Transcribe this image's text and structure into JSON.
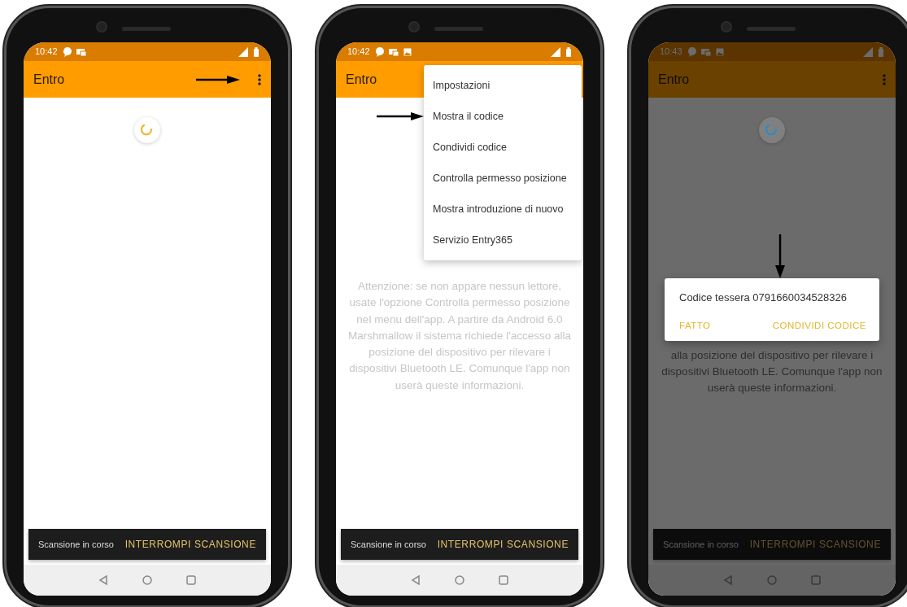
{
  "phones": [
    {
      "status_time": "10:42",
      "status_icons": [
        {
          "kind": "chat"
        },
        {
          "kind": "card"
        }
      ],
      "app_title": "Entro",
      "dimmed": false,
      "spinner": {
        "color": "#f0b429"
      },
      "arrow": {
        "kind": "overflow"
      },
      "snackbar": {
        "text": "Scansione in corso",
        "action": "INTERROMPI SCANSIONE"
      }
    },
    {
      "status_time": "10:42",
      "status_icons": [
        {
          "kind": "chat"
        },
        {
          "kind": "card"
        },
        {
          "kind": "image"
        }
      ],
      "app_title": "Entro",
      "dimmed": false,
      "menu": [
        {
          "label": "Impostazioni",
          "pointed": false
        },
        {
          "label": "Mostra il codice",
          "pointed": true
        },
        {
          "label": "Condividi codice",
          "pointed": false
        },
        {
          "label": "Controlla permesso posizione",
          "pointed": false
        },
        {
          "label": "Mostra introduzione di nuovo",
          "pointed": false
        },
        {
          "label": "Servizio Entry365",
          "pointed": false
        }
      ],
      "arrow": {
        "kind": "menu"
      },
      "message": "Attenzione: se non appare nessun lettore, usate l'opzione Controlla permesso posizione nel menu dell'app. A partire da Android 6.0 Marshmallow il sistema richiede l'accesso alla posizione del dispositivo per rilevare i dispositivi Bluetooth LE. Comunque l'app non userà queste informazioni.",
      "snackbar": {
        "text": "Scansione in corso",
        "action": "INTERROMPI SCANSIONE"
      }
    },
    {
      "status_time": "10:43",
      "status_icons": [
        {
          "kind": "chat"
        },
        {
          "kind": "card"
        },
        {
          "kind": "image"
        }
      ],
      "app_title": "Entro",
      "dimmed": true,
      "spinner": {
        "color": "#2b8cc4"
      },
      "arrow": {
        "kind": "dialog"
      },
      "dialog": {
        "text": "Codice tessera 0791660034528326",
        "buttons": [
          "FATTO",
          "CONDIVIDI CODICE"
        ]
      },
      "message": "alla posizione del dispositivo per rilevare i dispositivi Bluetooth LE. Comunque l'app non userà queste informazioni.",
      "snackbar": {
        "text": "Scansione in corso",
        "action": "INTERROMPI SCANSIONE"
      }
    }
  ]
}
